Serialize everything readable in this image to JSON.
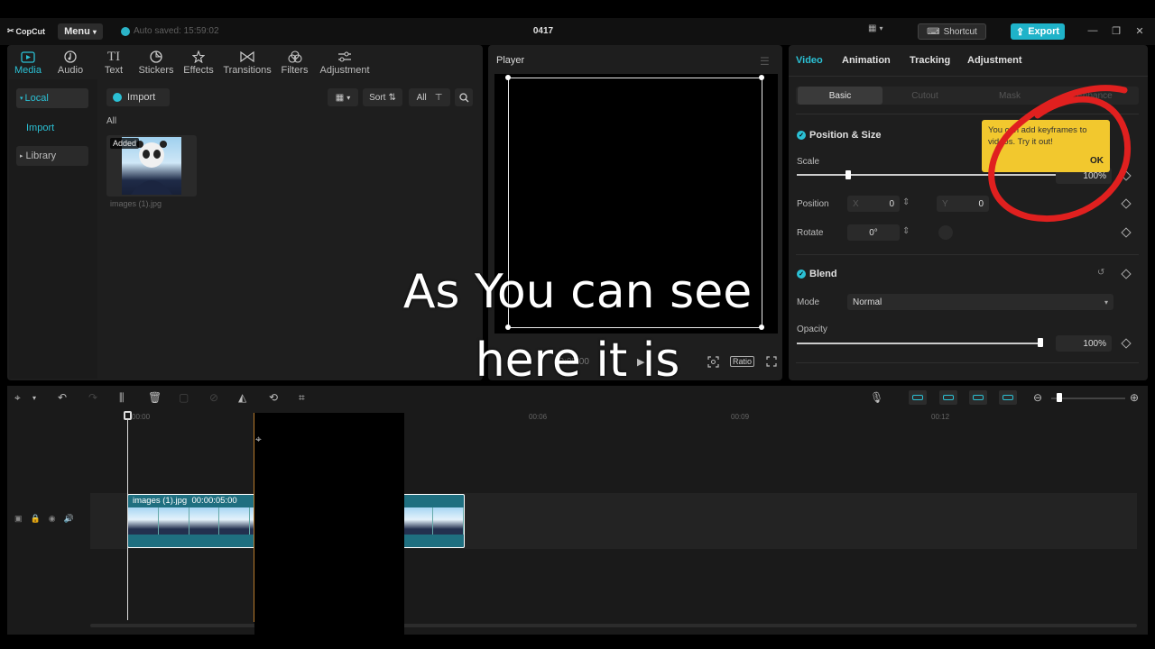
{
  "app": {
    "logo_text": "CopCut",
    "menu_label": "Menu",
    "autosave_text": "Auto saved: 15:59:02",
    "project_title": "0417",
    "shortcut_label": "Shortcut",
    "export_label": "Export"
  },
  "media_toolbar": {
    "tabs": [
      {
        "label": "Media",
        "icon": "media-icon"
      },
      {
        "label": "Audio",
        "icon": "audio-icon"
      },
      {
        "label": "Text",
        "icon": "text-icon",
        "glyph": "TI"
      },
      {
        "label": "Stickers",
        "icon": "stickers-icon"
      },
      {
        "label": "Effects",
        "icon": "effects-icon"
      },
      {
        "label": "Transitions",
        "icon": "transitions-icon"
      },
      {
        "label": "Filters",
        "icon": "filters-icon"
      },
      {
        "label": "Adjustment",
        "icon": "adjustment-icon"
      }
    ],
    "active_tab": "Media"
  },
  "media_sidebar": {
    "local_label": "Local",
    "import_label": "Import",
    "library_label": "Library"
  },
  "media_main": {
    "import_label": "Import",
    "sort_label": "Sort",
    "filter_all_label": "All",
    "section_label": "All",
    "items": [
      {
        "name": "images (1).jpg",
        "tag": "Added"
      }
    ]
  },
  "player": {
    "title": "Player",
    "timecode": "00:05:00",
    "ratio_label": "Ratio"
  },
  "properties": {
    "tabs": [
      "Video",
      "Animation",
      "Tracking",
      "Adjustment"
    ],
    "active_tab": "Video",
    "subtabs": [
      "Basic",
      "Cutout",
      "Mask",
      "Enhance"
    ],
    "active_subtab": "Basic",
    "position_size": {
      "title": "Position & Size",
      "scale_label": "Scale",
      "scale_value": "100%",
      "position_label": "Position",
      "x_label": "X",
      "x_value": "0",
      "y_label": "Y",
      "y_value": "0",
      "rotate_label": "Rotate",
      "rotate_value": "0°"
    },
    "blend": {
      "title": "Blend",
      "mode_label": "Mode",
      "mode_value": "Normal",
      "opacity_label": "Opacity",
      "opacity_value": "100%"
    },
    "tooltip": {
      "line1": "You can add keyframes to",
      "line2": "videos. Try it out!",
      "ok_label": "OK"
    }
  },
  "timeline": {
    "ruler": [
      "00:00",
      "00:06",
      "00:09",
      "00:12"
    ],
    "clip_name": "images (1).jpg",
    "clip_duration": "00:00:05:00"
  },
  "captions": {
    "line1": "As You can see",
    "line2": "here it is"
  },
  "colors": {
    "accent": "#2bc0d4",
    "tooltip_bg": "#f2c82e",
    "annotation_red": "#e0201f"
  }
}
